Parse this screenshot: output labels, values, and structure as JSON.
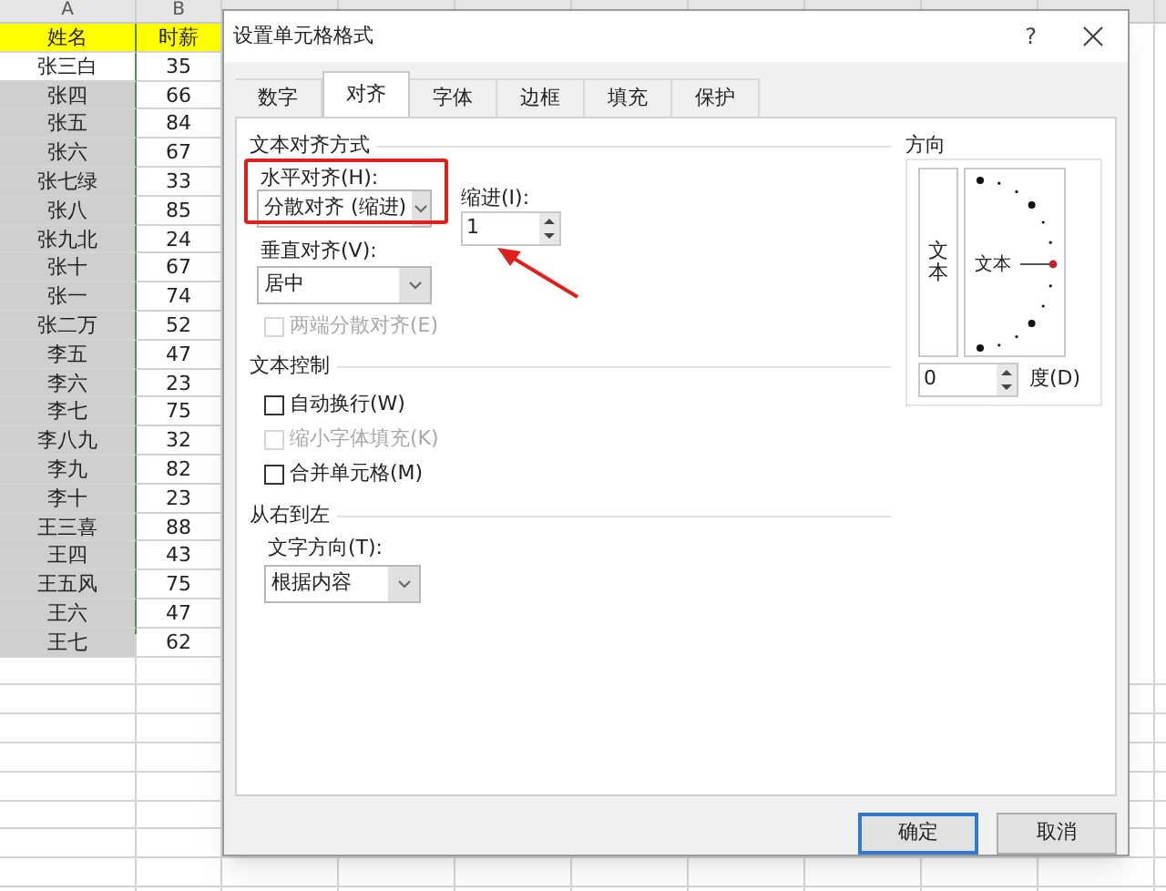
{
  "sheet": {
    "columns": [
      "A",
      "B"
    ],
    "header": [
      "姓名",
      "时薪"
    ],
    "rows": [
      {
        "cells": [
          "张三白",
          "35"
        ],
        "selected": false
      },
      {
        "cells": [
          "张四",
          "66"
        ],
        "selected": true
      },
      {
        "cells": [
          "张五",
          "84"
        ],
        "selected": true
      },
      {
        "cells": [
          "张六",
          "67"
        ],
        "selected": true
      },
      {
        "cells": [
          "张七绿",
          "33"
        ],
        "selected": true
      },
      {
        "cells": [
          "张八",
          "85"
        ],
        "selected": true
      },
      {
        "cells": [
          "张九北",
          "24"
        ],
        "selected": true
      },
      {
        "cells": [
          "张十",
          "67"
        ],
        "selected": true
      },
      {
        "cells": [
          "张一",
          "74"
        ],
        "selected": true
      },
      {
        "cells": [
          "张二万",
          "52"
        ],
        "selected": true
      },
      {
        "cells": [
          "李五",
          "47"
        ],
        "selected": true
      },
      {
        "cells": [
          "李六",
          "23"
        ],
        "selected": true
      },
      {
        "cells": [
          "李七",
          "75"
        ],
        "selected": true
      },
      {
        "cells": [
          "李八九",
          "32"
        ],
        "selected": true
      },
      {
        "cells": [
          "李九",
          "82"
        ],
        "selected": true
      },
      {
        "cells": [
          "李十",
          "23"
        ],
        "selected": true
      },
      {
        "cells": [
          "王三喜",
          "88"
        ],
        "selected": true
      },
      {
        "cells": [
          "王四",
          "43"
        ],
        "selected": true
      },
      {
        "cells": [
          "王五风",
          "75"
        ],
        "selected": true
      },
      {
        "cells": [
          "王六",
          "47"
        ],
        "selected": true
      },
      {
        "cells": [
          "王七",
          "62"
        ],
        "selected": true
      }
    ]
  },
  "dialog": {
    "title": "设置单元格格式",
    "help": "?",
    "tabs": [
      {
        "label": "数字",
        "selected": false
      },
      {
        "label": "对齐",
        "selected": true
      },
      {
        "label": "字体",
        "selected": false
      },
      {
        "label": "边框",
        "selected": false
      },
      {
        "label": "填充",
        "selected": false
      },
      {
        "label": "保护",
        "selected": false
      }
    ],
    "alignment": {
      "title": "文本对齐方式",
      "horizontal": {
        "label": "水平对齐(H):",
        "value": "分散对齐 (缩进)"
      },
      "indent": {
        "label": "缩进(I):",
        "value": "1"
      },
      "vertical": {
        "label": "垂直对齐(V):",
        "value": "居中"
      },
      "justify_distributed": {
        "label": "两端分散对齐(E)",
        "checked": false,
        "disabled": true
      }
    },
    "text_control": {
      "title": "文本控制",
      "options": [
        {
          "label": "自动换行(W)",
          "checked": false,
          "disabled": false
        },
        {
          "label": "缩小字体填充(K)",
          "checked": false,
          "disabled": true
        },
        {
          "label": "合并单元格(M)",
          "checked": false,
          "disabled": false
        }
      ]
    },
    "rtl": {
      "title": "从右到左",
      "direction": {
        "label": "文字方向(T):",
        "value": "根据内容"
      }
    },
    "orientation": {
      "title": "方向",
      "vertical_text": "文本",
      "dial_text": "文本",
      "degrees": {
        "value": "0",
        "unit": "度(D)"
      }
    },
    "buttons": [
      {
        "label": "确定",
        "default": true
      },
      {
        "label": "取消",
        "default": false
      }
    ]
  }
}
